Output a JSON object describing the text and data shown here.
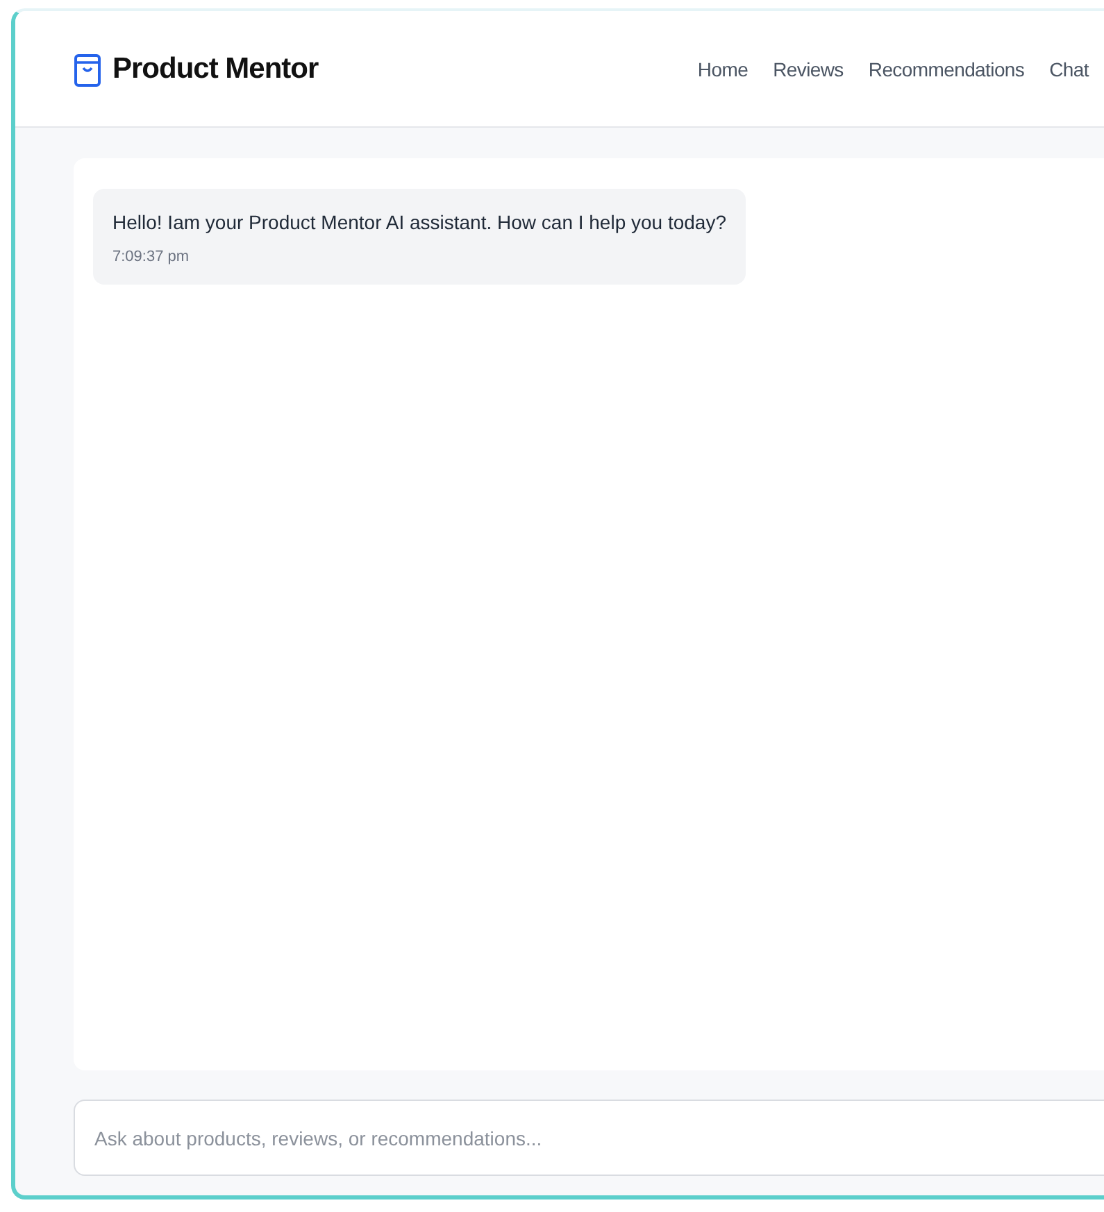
{
  "brand": {
    "title": "Product Mentor"
  },
  "nav": [
    {
      "label": "Home"
    },
    {
      "label": "Reviews"
    },
    {
      "label": "Recommendations"
    },
    {
      "label": "Chat"
    }
  ],
  "messages": [
    {
      "text": "Hello! Iam your Product Mentor AI assistant. How can I help you today?",
      "time": "7:09:37 pm"
    }
  ],
  "input": {
    "placeholder": "Ask about products, reviews, or recommendations..."
  }
}
